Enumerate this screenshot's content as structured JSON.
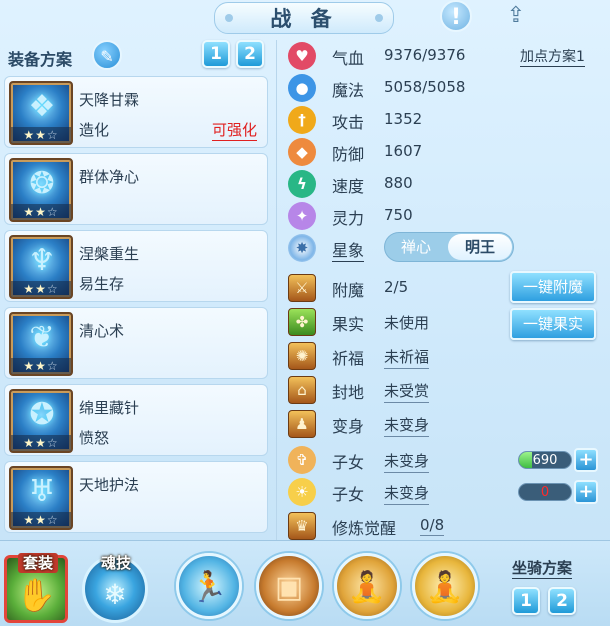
{
  "header": {
    "title": "战 备"
  },
  "icons": {
    "info": "!",
    "share": "⇪"
  },
  "equip_scheme": {
    "label": "装备方案",
    "buttons": [
      "1",
      "2"
    ]
  },
  "skills": [
    {
      "name": "天降甘霖",
      "effect": "造化",
      "enhance": "可强化",
      "stars": "★★☆",
      "glyph": "❖"
    },
    {
      "name": "群体净心",
      "effect": "",
      "enhance": "",
      "stars": "★★☆",
      "glyph": "❂"
    },
    {
      "name": "涅槃重生",
      "effect": "易生存",
      "enhance": "",
      "stars": "★★☆",
      "glyph": "♆"
    },
    {
      "name": "清心术",
      "effect": "",
      "enhance": "",
      "stars": "★★☆",
      "glyph": "❦"
    },
    {
      "name": "绵里藏针",
      "effect": "愤怒",
      "enhance": "",
      "stars": "★★☆",
      "glyph": "✪"
    },
    {
      "name": "天地护法",
      "effect": "",
      "enhance": "",
      "stars": "★★☆",
      "glyph": "♅"
    }
  ],
  "stats": [
    {
      "name": "气血",
      "value": "9376/9376",
      "color": "#e24a66",
      "icon": "♥"
    },
    {
      "name": "魔法",
      "value": "5058/5058",
      "color": "#3d95e6",
      "icon": "●"
    },
    {
      "name": "攻击",
      "value": "1352",
      "color": "#f0a91a",
      "icon": "†"
    },
    {
      "name": "防御",
      "value": "1607",
      "color": "#ee8a3e",
      "icon": "◆"
    },
    {
      "name": "速度",
      "value": "880",
      "color": "#29b786",
      "icon": "ϟ"
    },
    {
      "name": "灵力",
      "value": "750",
      "color": "#b786e8",
      "icon": "✦"
    }
  ],
  "add_point_link": "加点方案1",
  "constellation": {
    "label": "星象",
    "option_left": "禅心",
    "option_right": "明王"
  },
  "extras": [
    {
      "name": "附魔",
      "value": "2/5",
      "button": "一键附魔",
      "glyph": "⚔"
    },
    {
      "name": "果实",
      "value": "未使用",
      "button": "一键果实",
      "glyph": "✤"
    },
    {
      "name": "祈福",
      "value": "未祈福",
      "glyph": "✺"
    },
    {
      "name": "封地",
      "value": "未受赏",
      "glyph": "⌂"
    },
    {
      "name": "变身",
      "value": "未变身",
      "glyph": "♟"
    }
  ],
  "children": [
    {
      "name": "子女",
      "value": "未变身",
      "bar": "690",
      "fill": 0.25,
      "glyph": "✞"
    },
    {
      "name": "子女",
      "value": "未变身",
      "bar": "0",
      "fill": 0,
      "glyph": "☀"
    }
  ],
  "awakening": {
    "name": "修炼觉醒",
    "value": "0/8",
    "glyph": "♛"
  },
  "bottom": {
    "suit_label": "套装",
    "soul_label": "魂技",
    "mount_scheme_label": "坐骑方案",
    "mount_buttons": [
      "1",
      "2"
    ],
    "mount_glyphs": [
      "🏃",
      "▣",
      "🧘",
      "🧘"
    ]
  },
  "colors": {
    "accent_blue": "#2e9fe0",
    "highlight_red": "#e02020",
    "background": "#d3ecfc"
  }
}
